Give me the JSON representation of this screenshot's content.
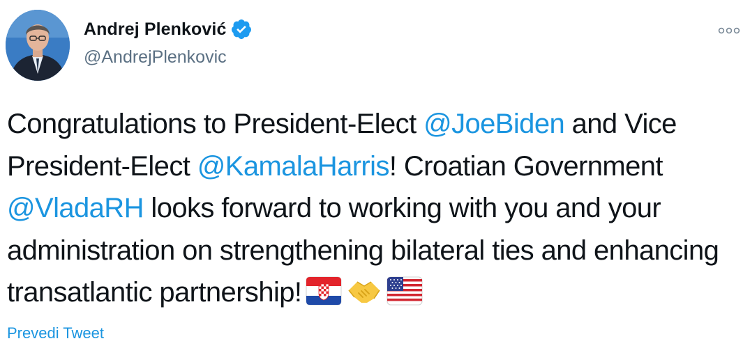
{
  "author": {
    "display_name": "Andrej Plenković",
    "handle": "@AndrejPlenkovic",
    "verified": true
  },
  "icons": {
    "avatar": "profile-photo",
    "verified": "verified-badge-icon",
    "more": "more-options-icon"
  },
  "tweet": {
    "t1": "Congratulations to President-Elect ",
    "m1": "@JoeBiden",
    "t2": " and Vice President-Elect ",
    "m2": "@KamalaHarris",
    "t3": "! Croatian Government ",
    "m3": "@VladaRH",
    "t4": " looks forward to working with you and your administration on strengthening bilateral ties and enhancing transatlantic partnership!",
    "emojis": [
      "croatia-flag",
      "handshake",
      "usa-flag"
    ]
  },
  "translate_label": "Prevedi Tweet",
  "colors": {
    "link": "#1b95e0",
    "text": "#0f1419",
    "secondary": "#5b7083"
  }
}
